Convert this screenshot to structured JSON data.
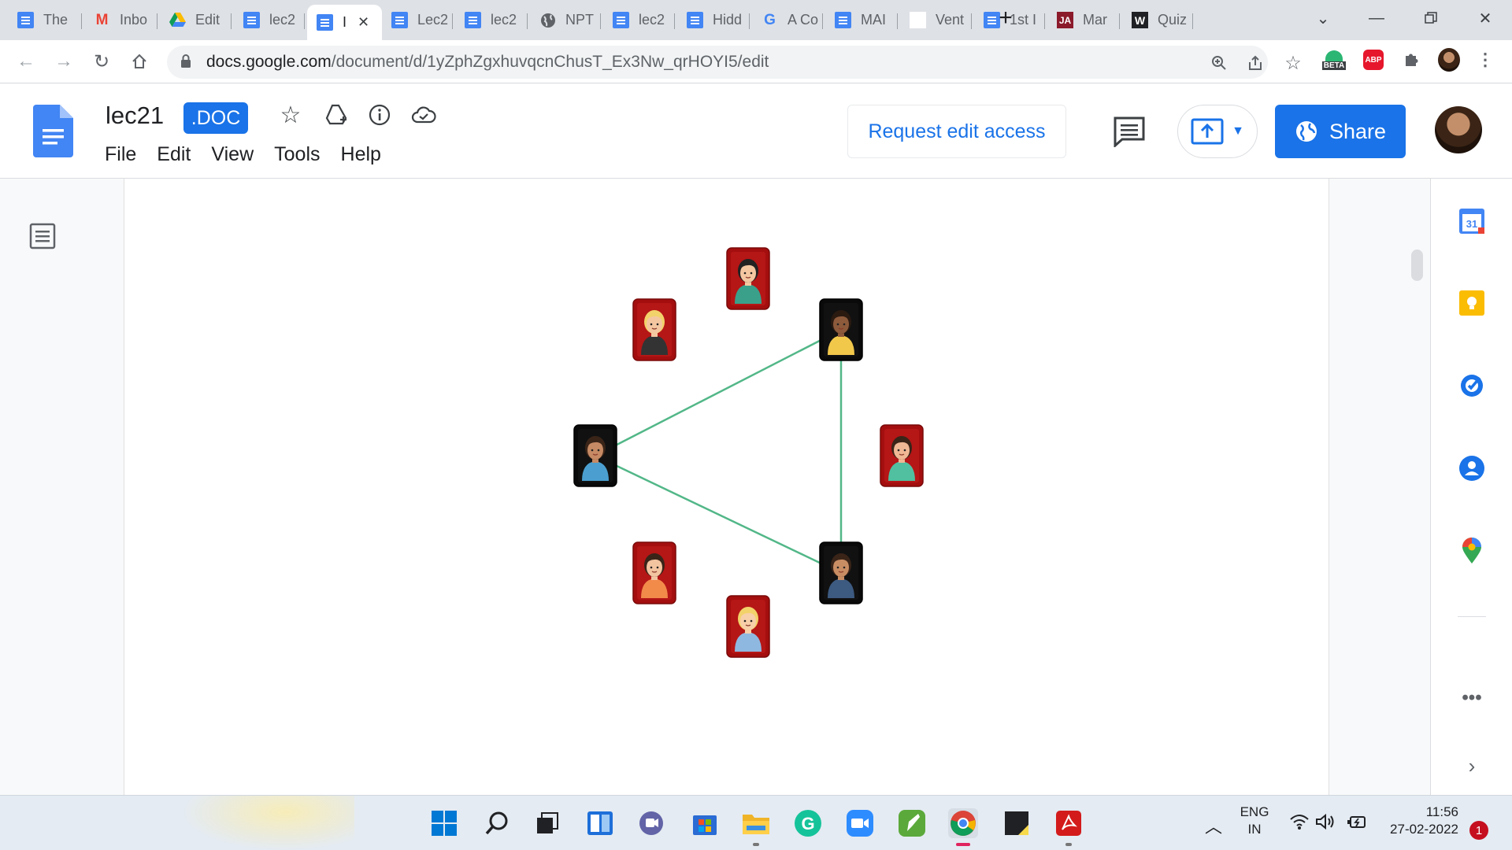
{
  "browser": {
    "tabs": [
      {
        "title": "The",
        "icon": "docs-icon"
      },
      {
        "title": "Inbo",
        "icon": "gmail-icon"
      },
      {
        "title": "Edit",
        "icon": "drive-icon"
      },
      {
        "title": "lec2",
        "icon": "docs-icon"
      },
      {
        "title": "I",
        "icon": "docs-icon",
        "active": true
      },
      {
        "title": "Lec2",
        "icon": "docs-icon"
      },
      {
        "title": "lec2",
        "icon": "docs-icon"
      },
      {
        "title": "NPT",
        "icon": "globe-icon"
      },
      {
        "title": "lec2",
        "icon": "docs-icon"
      },
      {
        "title": "Hidd",
        "icon": "docs-icon"
      },
      {
        "title": "A Co",
        "icon": "google-icon"
      },
      {
        "title": "MAI",
        "icon": "docs-icon"
      },
      {
        "title": "Vent",
        "icon": "blank-icon"
      },
      {
        "title": "1st I",
        "icon": "docs-icon"
      },
      {
        "title": "Mar",
        "icon": "ja-icon"
      },
      {
        "title": "Quiz",
        "icon": "w-icon"
      }
    ],
    "new_tab": "+",
    "url_host": "docs.google.com",
    "url_path": "/document/d/1yZphZgxhuvqcnChusT_Ex3Nw_qrHOYI5/edit",
    "beta_badge": "BETA",
    "abp_badge": "ABP"
  },
  "docs": {
    "title": "lec21",
    "badge": ".DOC",
    "menu": [
      "File",
      "Edit",
      "View",
      "Tools",
      "Help"
    ],
    "request_edit_label": "Request edit access",
    "share_label": "Share"
  },
  "diagram": {
    "line_color": "#52b788",
    "red_tile": "#a40e0e",
    "black_tile": "#0a0a0a",
    "nodes": [
      {
        "id": "top-woman",
        "tile": "red",
        "skin": "#f4c7a1",
        "hair": "#222",
        "shirt": "#3aa08a"
      },
      {
        "id": "blonde-woman",
        "tile": "red",
        "skin": "#f4c7a1",
        "hair": "#f2d26a",
        "shirt": "#333"
      },
      {
        "id": "man-yellow",
        "tile": "black",
        "skin": "#8d5a3b",
        "hair": "#2a1a10",
        "shirt": "#f2c84b"
      },
      {
        "id": "woman-left",
        "tile": "black",
        "skin": "#c68a64",
        "hair": "#3a2418",
        "shirt": "#4a9fd0"
      },
      {
        "id": "man-green",
        "tile": "red",
        "skin": "#f0b894",
        "hair": "#3a2418",
        "shirt": "#50c0a0"
      },
      {
        "id": "man-glasses",
        "tile": "red",
        "skin": "#f3c4a0",
        "hair": "#3a2418",
        "shirt": "#f28a4a"
      },
      {
        "id": "man-dark",
        "tile": "black",
        "skin": "#c98d64",
        "hair": "#3a2418",
        "shirt": "#3d5a80"
      },
      {
        "id": "bottom-woman",
        "tile": "red",
        "skin": "#f7cfa8",
        "hair": "#f2d26a",
        "shirt": "#8fb8e0"
      }
    ],
    "edges": [
      [
        "woman-left",
        "man-yellow"
      ],
      [
        "woman-left",
        "man-dark"
      ],
      [
        "man-yellow",
        "man-dark"
      ]
    ]
  },
  "taskbar": {
    "lang_line1": "ENG",
    "lang_line2": "IN",
    "time": "11:56",
    "date": "27-02-2022",
    "notifications": "1"
  }
}
